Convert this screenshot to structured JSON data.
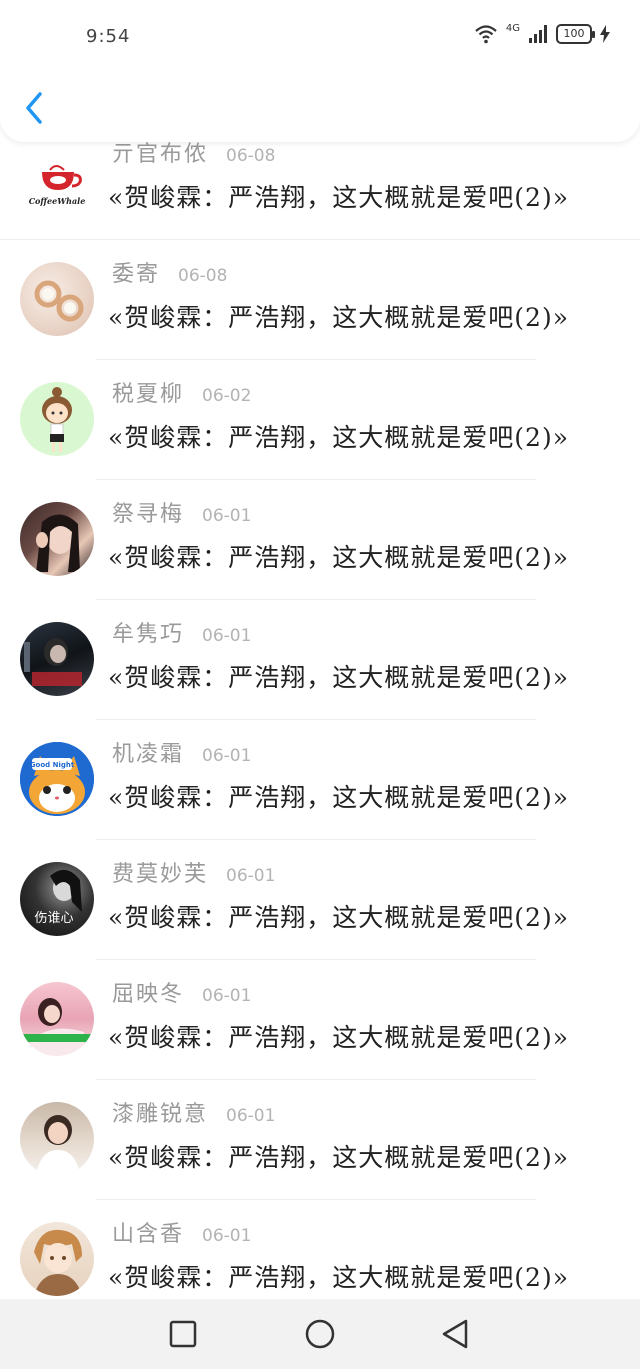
{
  "status_bar": {
    "time": "9:54",
    "network": "4G",
    "battery": "100"
  },
  "header": {
    "back_icon": "chevron-left-icon",
    "accent_color": "#2196f3"
  },
  "items": [
    {
      "name": "亓官布侬",
      "date": "06-08",
      "title": "«贺峻霖：严浩翔，这大概就是爱吧(2)»",
      "avatar": "coffeewhale-logo",
      "logo_text": "CoffeeWhale"
    },
    {
      "name": "委寄",
      "date": "06-08",
      "title": "«贺峻霖：严浩翔，这大概就是爱吧(2)»",
      "avatar": "earrings"
    },
    {
      "name": "税夏柳",
      "date": "06-02",
      "title": "«贺峻霖：严浩翔，这大概就是爱吧(2)»",
      "avatar": "cartoon-girl"
    },
    {
      "name": "祭寻梅",
      "date": "06-01",
      "title": "«贺峻霖：严浩翔，这大概就是爱吧(2)»",
      "avatar": "girl-photo"
    },
    {
      "name": "牟隽巧",
      "date": "06-01",
      "title": "«贺峻霖：严浩翔，这大概就是爱吧(2)»",
      "avatar": "dark-photo"
    },
    {
      "name": "机凌霜",
      "date": "06-01",
      "title": "«贺峻霖：严浩翔，这大概就是爱吧(2)»",
      "avatar": "cartoon-cat",
      "badge_text": "Good Night"
    },
    {
      "name": "费莫妙芙",
      "date": "06-01",
      "title": "«贺峻霖：严浩翔，这大概就是爱吧(2)»",
      "avatar": "bw-photo",
      "overlay_text": "伤谁心"
    },
    {
      "name": "屈映冬",
      "date": "06-01",
      "title": "«贺峻霖：严浩翔，这大概就是爱吧(2)»",
      "avatar": "pink-photo"
    },
    {
      "name": "漆雕锐意",
      "date": "06-01",
      "title": "«贺峻霖：严浩翔，这大概就是爱吧(2)»",
      "avatar": "woman-photo"
    },
    {
      "name": "山含香",
      "date": "06-01",
      "title": "«贺峻霖：严浩翔，这大概就是爱吧(2)»",
      "avatar": "anime-boy"
    }
  ],
  "navbar": {
    "recent_icon": "square-icon",
    "home_icon": "circle-icon",
    "back_icon": "triangle-back-icon"
  }
}
